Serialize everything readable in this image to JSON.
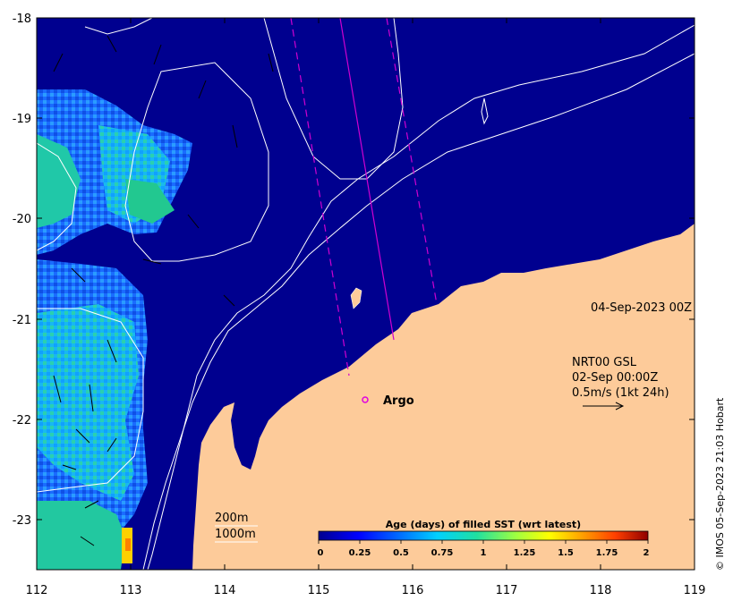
{
  "map": {
    "x_ticks": [
      "112",
      "113",
      "114",
      "115",
      "116",
      "117",
      "118",
      "119"
    ],
    "y_ticks": [
      "-18",
      "-19",
      "-20",
      "-21",
      "-22",
      "-23"
    ],
    "date_label": "04-Sep-2023 00Z",
    "current_legend": {
      "line1": "NRT00 GSL",
      "line2": "02-Sep 00:00Z",
      "line3": "0.5m/s (1kt 24h)"
    },
    "argo_label": "Argo",
    "contour_labels": {
      "c200": "200m",
      "c1000": "1000m"
    },
    "colorbar": {
      "title": "Age (days) of filled SST (wrt latest)",
      "ticks": [
        "0",
        "0.25",
        "0.5",
        "0.75",
        "1",
        "1.25",
        "1.5",
        "1.75",
        "2"
      ]
    },
    "copyright": "© IMOS 05-Sep-2023 21:03 Hobart",
    "colors": {
      "ocean_recent": "#00008f",
      "land": "#fdcb9a",
      "argo_marker": "#e000e0",
      "track_lines": "#d000d0"
    }
  }
}
